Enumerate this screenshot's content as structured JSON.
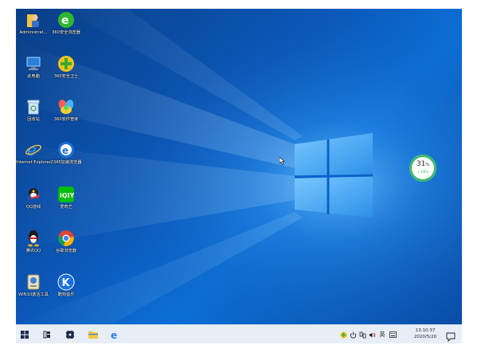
{
  "desktop": {
    "icons": [
      {
        "name": "administrator-folder",
        "label": "Administrat..."
      },
      {
        "name": "360-browser",
        "label": "360安全浏览器"
      },
      {
        "name": "this-pc",
        "label": "此电脑"
      },
      {
        "name": "360-guard",
        "label": "360安全卫士"
      },
      {
        "name": "recycle-bin",
        "label": "回收站"
      },
      {
        "name": "360-software-manager",
        "label": "360软件管家"
      },
      {
        "name": "internet-explorer",
        "label": "Internet Explorer"
      },
      {
        "name": "2345-browser",
        "label": "2345加速浏览器"
      },
      {
        "name": "qq-game",
        "label": "QQ游戏"
      },
      {
        "name": "iqiyi",
        "label": "爱奇艺"
      },
      {
        "name": "tencent-qq",
        "label": "腾讯QQ"
      },
      {
        "name": "chrome",
        "label": "谷歌浏览器"
      },
      {
        "name": "win10-activator",
        "label": "WIN10激活工具"
      },
      {
        "name": "kugou-music",
        "label": "酷狗音乐"
      }
    ]
  },
  "widget": {
    "cpu_percent": "31",
    "percent_sign": "%",
    "speed": "↓ 0K/s"
  },
  "taskbar": {
    "start": "start-icon",
    "pinned": [
      "task-view-icon",
      "360-software-icon",
      "file-explorer-icon",
      "edge-icon"
    ],
    "tray": [
      "360-tray-icon",
      "power-tray-icon",
      "network-tray-icon",
      "volume-tray-icon",
      "ime-tray-icon",
      "keyboard-tray-icon"
    ],
    "ime_label": "英",
    "time": "13:10:37",
    "date": "2020/5/20"
  },
  "colors": {
    "accent": "#0c6fd6",
    "taskbar": "#e7eef8",
    "widget_ring": "#3bb86a"
  }
}
